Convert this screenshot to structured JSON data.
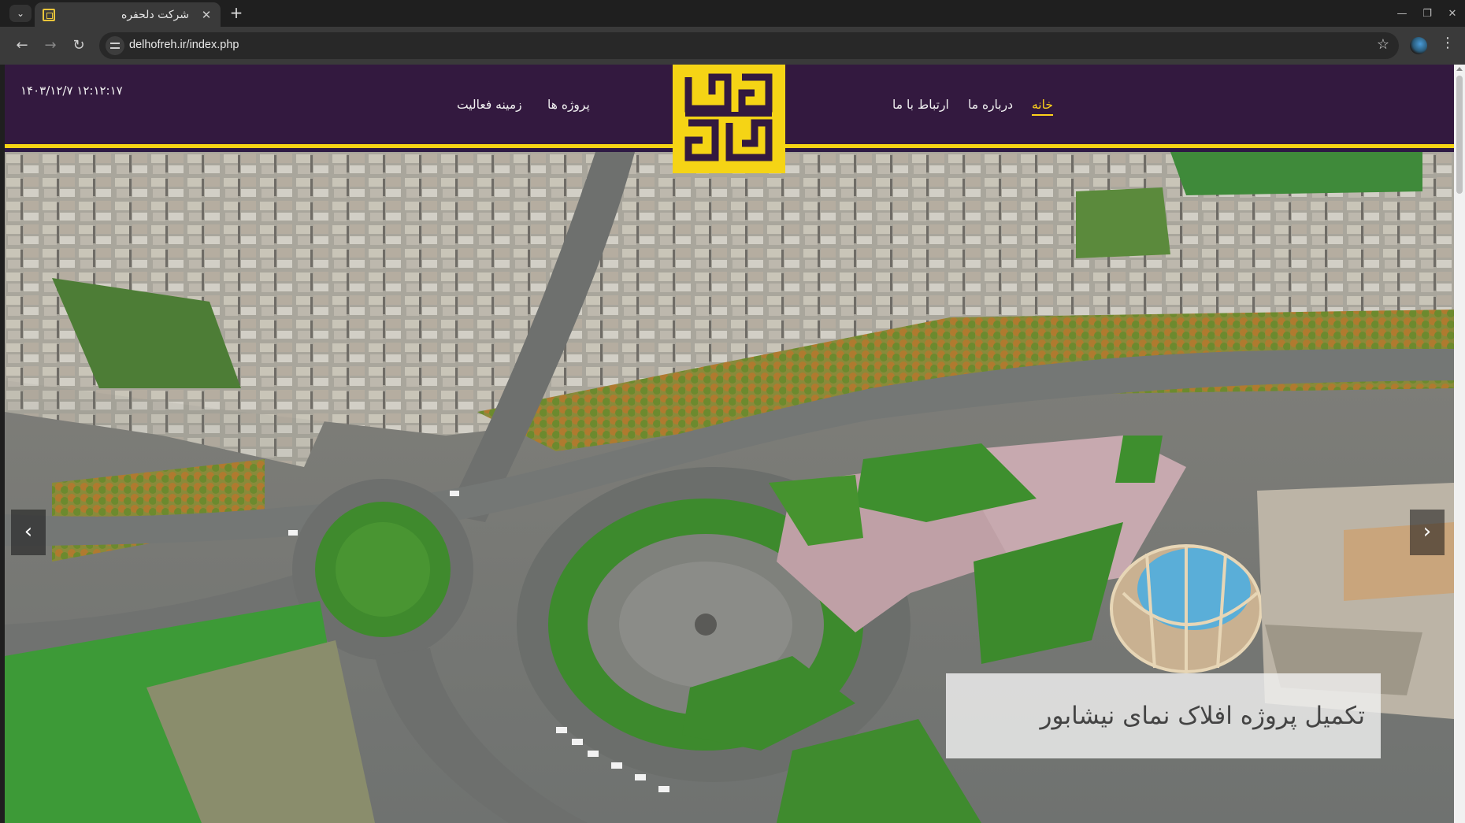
{
  "browser": {
    "tab_title": "شرکت دلحفره",
    "url": "delhofreh.ir/index.php",
    "new_tab": "+",
    "close_tab": "✕"
  },
  "site": {
    "datetime": "۱۴۰۳/۱۲/۷  ۱۲:۱۲:۱۷",
    "nav": {
      "home": "خانه",
      "about": "درباره ما",
      "contact": "ارتباط با ما",
      "projects": "پروژه ها",
      "activity": "زمینه فعالیت"
    },
    "colors": {
      "header_bg": "#33193f",
      "accent": "#f5d415",
      "active_link": "#ffd21a"
    }
  },
  "slider": {
    "caption": "تکمیل پروژه افلاک نمای نیشابور",
    "prev_icon": "‹",
    "next_icon": "›"
  },
  "icons": {
    "tab_search": "chevron-down-icon",
    "back": "back-arrow-icon",
    "forward": "forward-arrow-icon",
    "reload": "reload-icon",
    "site_info": "site-info-icon",
    "bookmark": "star-icon",
    "menu": "kebab-menu-icon"
  }
}
